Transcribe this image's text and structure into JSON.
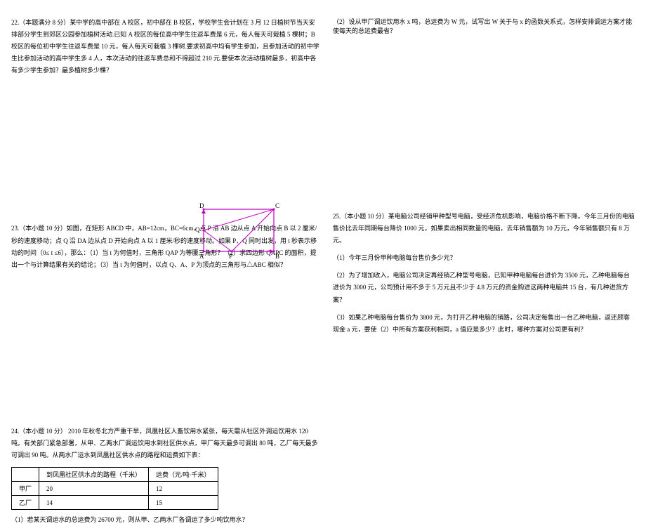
{
  "q22": {
    "text": "22.（本题满分 8 分）某中学的高中部在 A 校区，初中部在 B 校区，学校学生会计划在 3 月 12 日植树节当天安排部分学生到郊区公园参加植树活动.已知 A 校区的每位高中学生往返车费是 6 元，每人每天可栽植 5 棵树；B 校区的每位初中学生往返车费是 10 元，每人每天可栽植 3 棵树.要求初高中均有学生参加，且参加活动的初中学生比参加活动的高中学生多 4 人，本次活动的往返车费总和不得超过 210 元.要使本次活动植树最多，初高中各有多少学生参加？最多植树多少棵？"
  },
  "q23": {
    "text": "23.（本小题 10 分）如图，在矩形 ABCD 中，AB=12cm，BC=6cm，点 P 沿 AB 边从点 A 开始向点 B 以 2 厘米/秒的速度移动；点 Q 沿 DA 边从点 D 开始向点 A 以 1 厘米/秒的速度移动。如果 P、Q 同时出发，用 t 秒表示移动的时间（0≤ t ≤6），那么：（1）当 t 为何值时，三角形 QAP 为等腰三角形？（2）求四边形 QAPC 的面积，提出一个与计算结果有关的结论；（3）当 t 为何值时，以点 Q、A、P 为顶点的三角形与△ABC 相似？"
  },
  "q24": {
    "text": "24.（本小题 10 分） 2010 年秋冬北方严重干旱，凤凰社区人畜饮用水紧张，每天需从社区外调运饮用水 120 吨。有关部门紧急部署，从甲、乙两水厂调运饮用水到社区供水点，甲厂每天最多可调出 80 吨，乙厂每天最多可调出 90 吨。从两水厂运水到凤凰社区供水点的路程和运费如下表：",
    "table": {
      "header": [
        "",
        "到凤凰社区供水点的路程（千米）",
        "运费（元/吨·千米）"
      ],
      "rows": [
        [
          "甲厂",
          "20",
          "12"
        ],
        [
          "乙厂",
          "14",
          "15"
        ]
      ]
    },
    "sub1": "（1）若某天调运水的总运费为 26700 元，则从甲、乙两水厂各调运了多少吨饮用水？"
  },
  "r1": {
    "text": "（2）设从甲厂调运饮用水 x 吨，总运费为 W 元，试写出 W 关于与 x 的函数关系式，怎样安排调运方案才能使每天的总运费最省？"
  },
  "q25": {
    "text": "25.（本小题 10 分）某电脑公司经销甲种型号电脑，受经济危机影响，电脑价格不断下降。今年三月份的电脑售价比去年同期每台降价 1000 元，如果卖出相同数量的电脑，去年销售额为 10 万元，今年销售额只有 8 万元。",
    "p1": "（1）今年三月份甲种电脑每台售价多少元？",
    "p2": "（2）为了增加收入，电脑公司决定再经销乙种型号电脑，已知甲种电脑每台进价为 3500 元，乙种电脑每台进价为 3000 元，公司预计用不多于 5 万元且不少于 4.8 万元的资金购进这两种电脑共 15 台，有几种进货方案？",
    "p3": "（3）如果乙种电脑每台售价为 3800 元，为打开乙种电脑的销路，公司决定每售出一台乙种电脑，返还顾客现金 a 元，要使（2）中所有方案获利相同，a 值应是多少？此时，哪种方案对公司更有利？"
  },
  "figure": {
    "labels": {
      "A": "A",
      "B": "B",
      "C": "C",
      "D": "D",
      "P": "P",
      "Q": "Q"
    }
  }
}
